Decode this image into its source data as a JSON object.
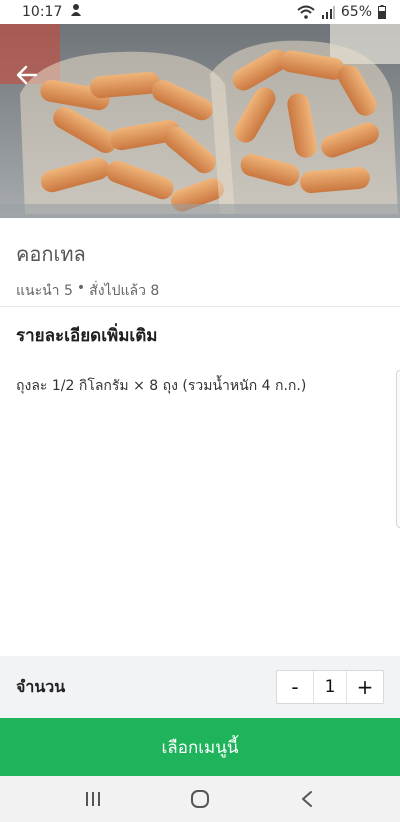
{
  "status_bar": {
    "time": "10:17",
    "battery": "65%",
    "icons": [
      "notification-icon",
      "wifi-icon",
      "signal-icon",
      "battery-icon"
    ]
  },
  "hero": {
    "image_name": "sausage-bags-photo"
  },
  "item": {
    "name": "คอกเทล",
    "recommend": "แนะนำ 5",
    "separator": "•",
    "ordered": "สั่งไปแล้ว 8"
  },
  "details": {
    "title": "รายละเอียดเพิ่มเติม",
    "body": "ถุงละ 1/2 กิโลกรัม × 8 ถุง (รวมน้ำหนัก 4 ก.ก.)"
  },
  "quantity": {
    "label": "จำนวน",
    "minus": "-",
    "value": "1",
    "plus": "+"
  },
  "cta": {
    "label": "เลือกเมนูนี้"
  },
  "colors": {
    "accent": "#1fb45b",
    "qty_bar_bg": "#f2f3f5",
    "nav_bg": "#f2f2f2"
  }
}
